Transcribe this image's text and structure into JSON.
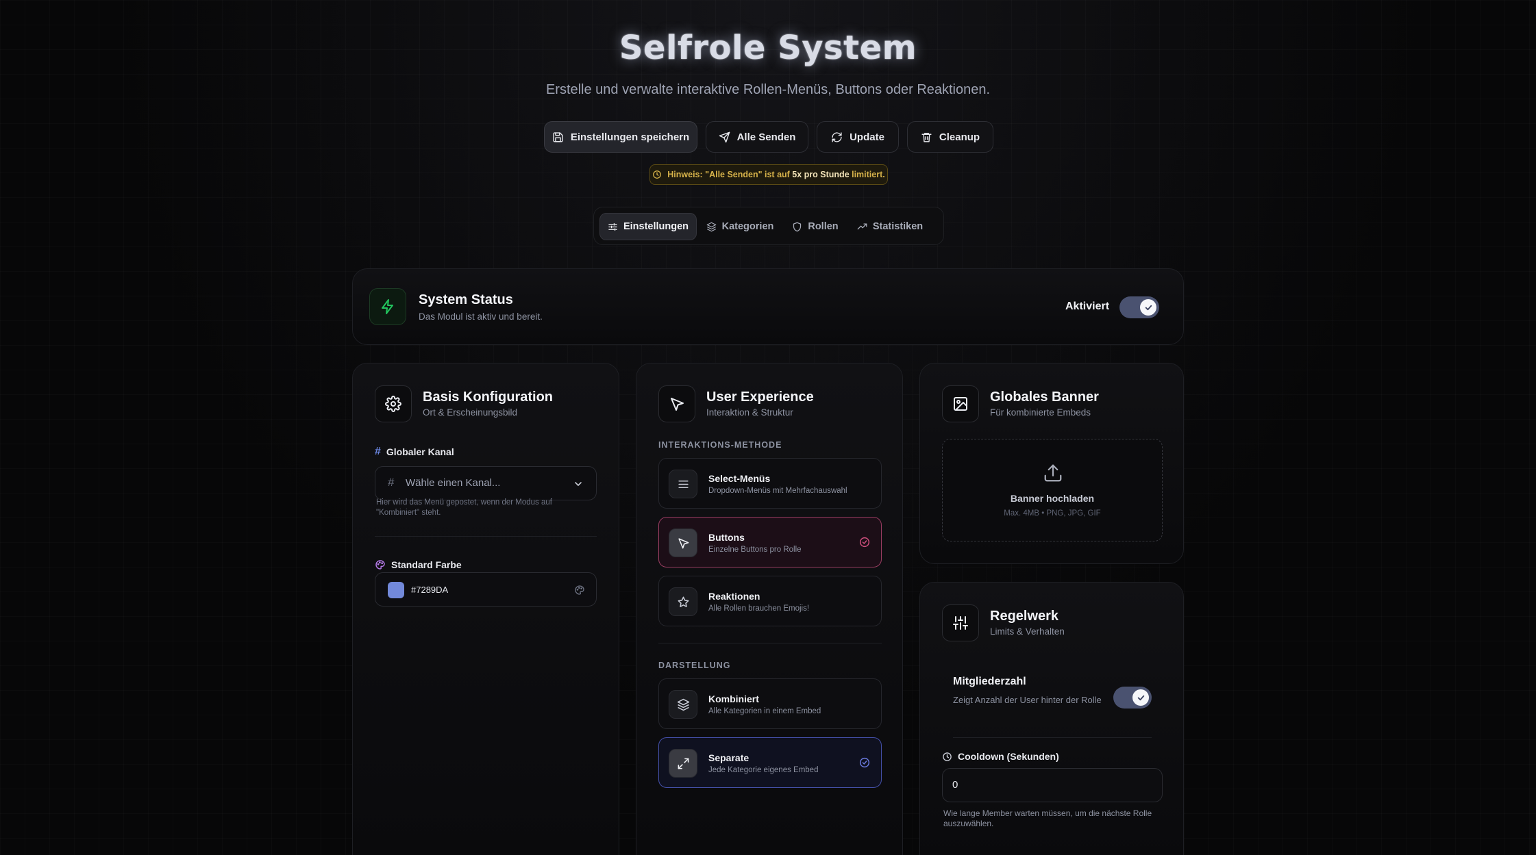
{
  "header": {
    "title": "Selfrole System",
    "subtitle": "Erstelle und verwalte interaktive Rollen-Menüs, Buttons oder Reaktionen."
  },
  "actions": {
    "save": "Einstellungen speichern",
    "send_all": "Alle Senden",
    "update": "Update",
    "cleanup": "Cleanup"
  },
  "hint": {
    "prefix": "Hinweis: \"Alle Senden\" ist auf ",
    "emphasis": "5x pro Stunde",
    "suffix": " limitiert."
  },
  "tabs": [
    "Einstellungen",
    "Kategorien",
    "Rollen",
    "Statistiken"
  ],
  "status": {
    "title": "System Status",
    "subtitle": "Das Modul ist aktiv und bereit.",
    "toggle_label": "Aktiviert",
    "enabled": true
  },
  "basis": {
    "title": "Basis Konfiguration",
    "subtitle": "Ort & Erscheinungsbild",
    "channel_label": "Globaler Kanal",
    "channel_placeholder": "Wähle einen Kanal...",
    "channel_help": "Hier wird das Menü gepostet, wenn der Modus auf \"Kombiniert\" steht.",
    "color_label": "Standard Farbe",
    "color_value": "#7289DA"
  },
  "ux": {
    "title": "User Experience",
    "subtitle": "Interaktion & Struktur",
    "method_header": "INTERAKTIONS-METHODE",
    "methods": [
      {
        "title": "Select-Menüs",
        "desc": "Dropdown-Menüs mit Mehrfachauswahl",
        "icon": "list-icon",
        "selected": false
      },
      {
        "title": "Buttons",
        "desc": "Einzelne Buttons pro Rolle",
        "icon": "cursor-icon",
        "selected": true
      },
      {
        "title": "Reaktionen",
        "desc": "Alle Rollen brauchen Emojis!",
        "icon": "star-icon",
        "selected": false
      }
    ],
    "display_header": "DARSTELLUNG",
    "displays": [
      {
        "title": "Kombiniert",
        "desc": "Alle Kategorien in einem Embed",
        "icon": "layers-icon",
        "selected": false
      },
      {
        "title": "Separate",
        "desc": "Jede Kategorie eigenes Embed",
        "icon": "expand-icon",
        "selected": true
      }
    ]
  },
  "banner": {
    "title": "Globales Banner",
    "subtitle": "Für kombinierte Embeds",
    "upload_label": "Banner hochladen",
    "upload_hint": "Max. 4MB • PNG, JPG, GIF"
  },
  "rules": {
    "title": "Regelwerk",
    "subtitle": "Limits & Verhalten",
    "member_count_title": "Mitgliederzahl",
    "member_count_desc": "Zeigt Anzahl der User hinter der Rolle",
    "member_count_enabled": true,
    "cooldown_label": "Cooldown (Sekunden)",
    "cooldown_value": "0",
    "cooldown_help": "Wie lange Member warten müssen, um die nächste Rolle auszuwählen."
  },
  "colors": {
    "accent_green": "#22c55e",
    "accent_pink": "#9a3d62",
    "accent_blue": "#4450a8",
    "swatch": "#7289DA",
    "hint_yellow": "#d6b24a"
  }
}
